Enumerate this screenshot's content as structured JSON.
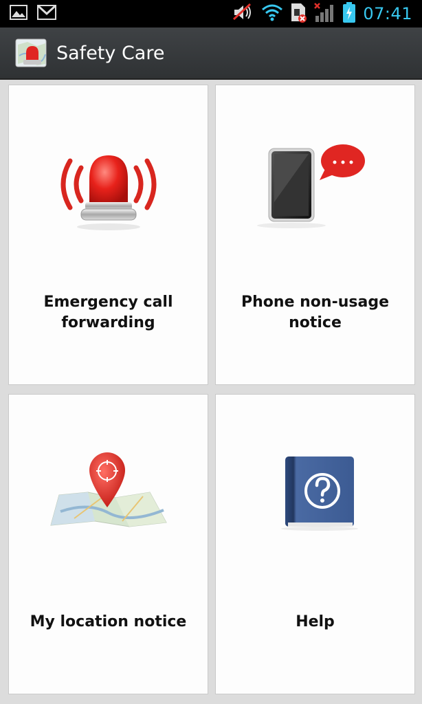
{
  "status_bar": {
    "icons": [
      "gallery-icon",
      "gmail-icon",
      "mute-icon",
      "wifi-icon",
      "sim-error-icon",
      "signal-icon",
      "battery-charging-icon"
    ],
    "time": "07:41",
    "accent_color": "#38c8f0"
  },
  "app": {
    "title": "Safety Care",
    "icon": "safety-care-map-alarm-icon"
  },
  "tiles": [
    {
      "label": "Emergency call forwarding",
      "icon": "siren-icon"
    },
    {
      "label": "Phone non-usage notice",
      "icon": "phone-message-icon"
    },
    {
      "label": "My location notice",
      "icon": "map-pin-icon"
    },
    {
      "label": "Help",
      "icon": "help-book-icon"
    }
  ]
}
